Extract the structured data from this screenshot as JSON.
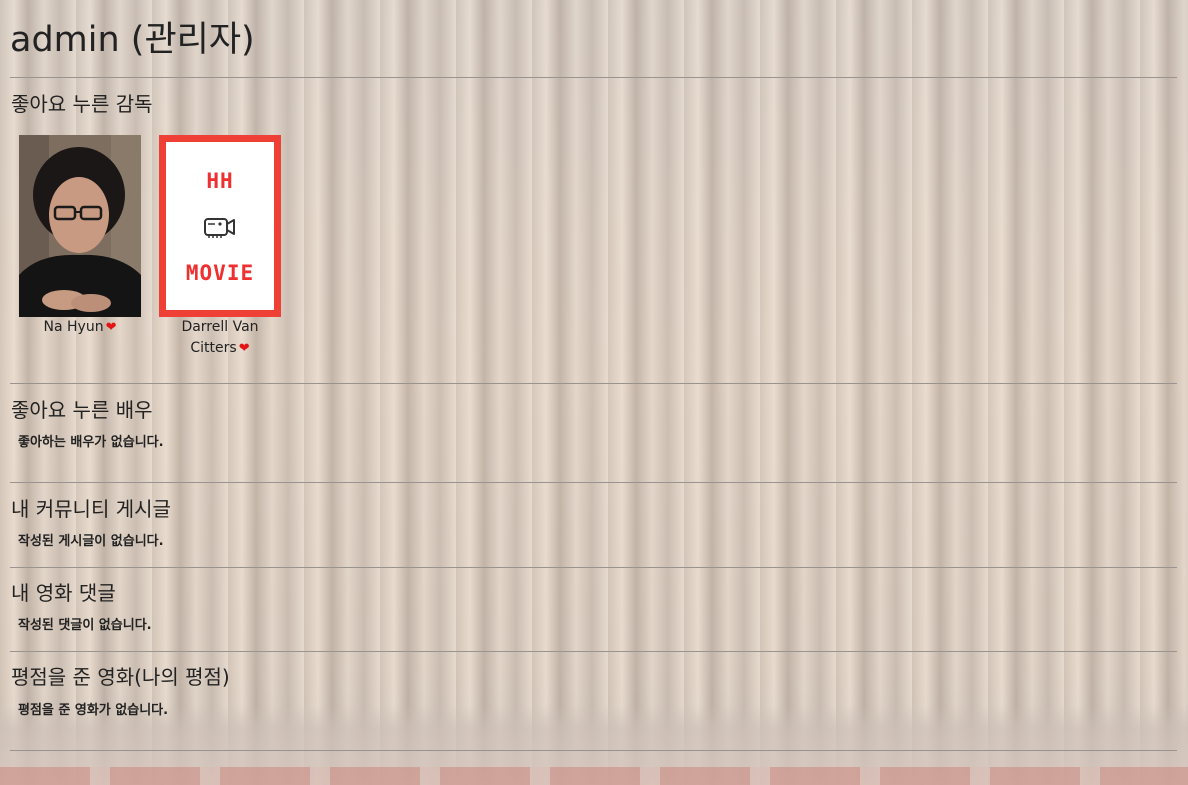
{
  "page": {
    "title": "admin (관리자)"
  },
  "directors": {
    "heading": "좋아요 누른 감독",
    "items": [
      {
        "name": "Na Hyun",
        "heart": "❤"
      },
      {
        "name_line1": "Darrell Van",
        "name_line2": "Citters",
        "heart": "❤",
        "poster_top": "HH",
        "poster_bottom": "MOVIE"
      }
    ]
  },
  "actors": {
    "heading": "좋아요 누른 배우",
    "empty": "좋아하는 배우가 없습니다."
  },
  "posts": {
    "heading": "내 커뮤니티 게시글",
    "empty": "작성된 게시글이 없습니다."
  },
  "comments": {
    "heading": "내 영화 댓글",
    "empty": "작성된 댓글이 없습니다."
  },
  "ratings": {
    "heading": "평점을 준 영화(나의 평점)",
    "empty": "평점을 준 영화가 없습니다."
  },
  "colors": {
    "heart": "#e31414",
    "poster_accent": "#ee4035"
  }
}
